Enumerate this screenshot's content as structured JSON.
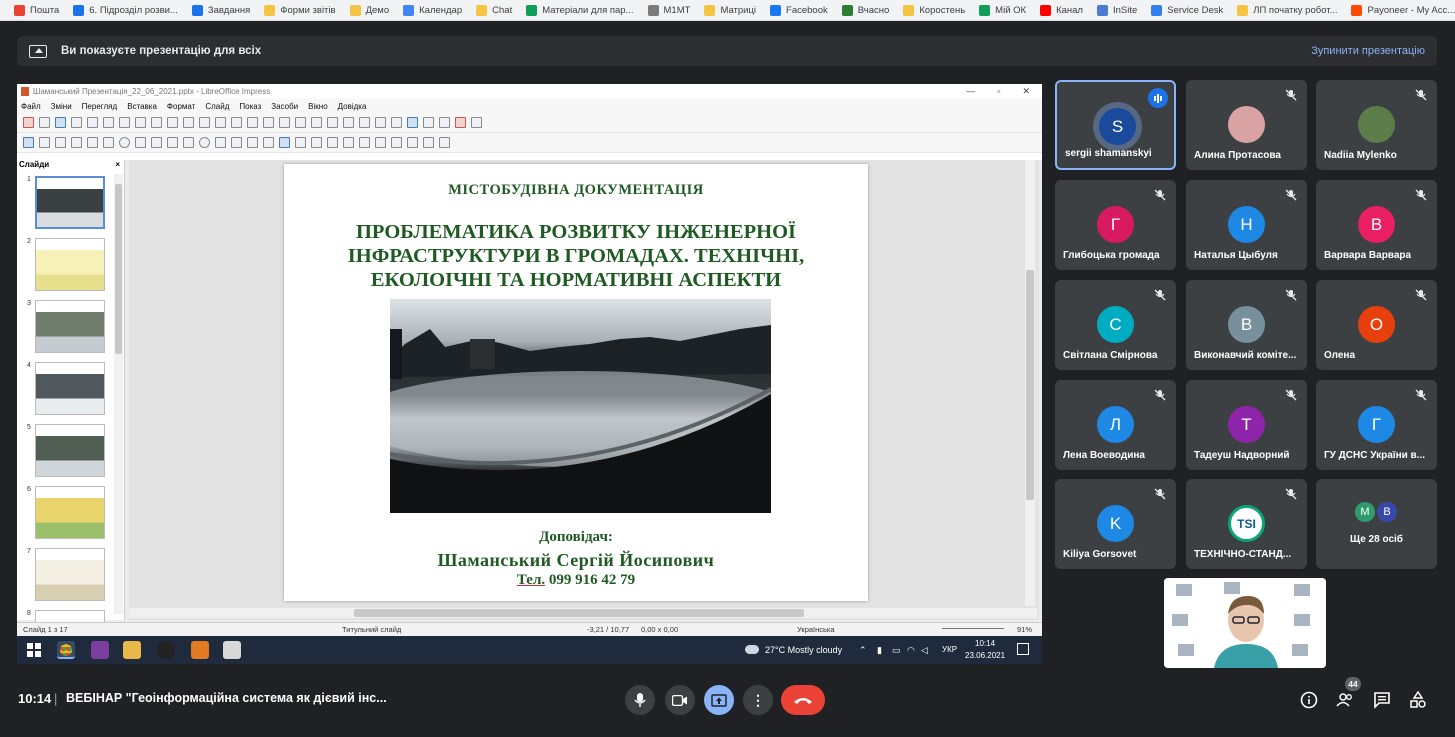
{
  "bookmarks": [
    {
      "label": "Пошта",
      "icon": "gmail-icon",
      "color": "#ea4335"
    },
    {
      "label": "6. Підрозділ розви...",
      "icon": "drive-icon",
      "color": "#1a73e8"
    },
    {
      "label": "Завдання",
      "icon": "calendar-24-icon",
      "color": "#1a73e8"
    },
    {
      "label": "Форми звітів",
      "icon": "folder-icon",
      "color": "#f4c542"
    },
    {
      "label": "Демо",
      "icon": "folder-icon",
      "color": "#f4c542"
    },
    {
      "label": "Календар",
      "icon": "calendar-icon",
      "color": "#4285f4"
    },
    {
      "label": "Chat",
      "icon": "folder-icon",
      "color": "#f4c542"
    },
    {
      "label": "Матеріали для пар...",
      "icon": "sheets-icon",
      "color": "#0f9d58"
    },
    {
      "label": "M1MT",
      "icon": "m1mt-icon",
      "color": "#7b7b7b"
    },
    {
      "label": "Матриці",
      "icon": "folder-icon",
      "color": "#f4c542"
    },
    {
      "label": "Facebook",
      "icon": "facebook-icon",
      "color": "#1877f2"
    },
    {
      "label": "Вчасно",
      "icon": "vchasno-icon",
      "color": "#2e7d32"
    },
    {
      "label": "Коростень",
      "icon": "folder-icon",
      "color": "#f4c542"
    },
    {
      "label": "Мій ОК",
      "icon": "sheets-icon",
      "color": "#0f9d58"
    },
    {
      "label": "Канал",
      "icon": "youtube-icon",
      "color": "#ff0000"
    },
    {
      "label": "InSite",
      "icon": "insite-icon",
      "color": "#4a7bd0"
    },
    {
      "label": "Service Desk",
      "icon": "servicedesk-icon",
      "color": "#2f80ed"
    },
    {
      "label": "ЛП початку робот...",
      "icon": "folder-icon",
      "color": "#f4c542"
    },
    {
      "label": "Payoneer - My Acc...",
      "icon": "payoneer-icon",
      "color": "#ff4800"
    }
  ],
  "banner": {
    "text": "Ви показуєте презентацію для всіх",
    "stop_label": "Зупинити презентацію"
  },
  "shared": {
    "window_title": "Шаманський Презентація_22_06_2021.pptx - LibreOffice Impress",
    "menu": [
      "Файл",
      "Зміни",
      "Перегляд",
      "Вставка",
      "Формат",
      "Слайд",
      "Показ",
      "Засоби",
      "Вікно",
      "Довідка"
    ],
    "slides_label": "Слайди",
    "slide_numbers": [
      "1",
      "2",
      "3",
      "4",
      "5",
      "6",
      "7",
      "8"
    ],
    "slide": {
      "top": "МІСТОБУДІВНА  ДОКУМЕНТАЦІЯ",
      "title": "ПРОБЛЕМАТИКА РОЗВИТКУ ІНЖЕНЕРНОЇ ІНФРАСТРУКТУРИ В ГРОМАДАХ. ТЕХНІЧНІ, ЕКОЛОІЧНІ ТА НОРМАТИВНІ АСПЕКТИ",
      "reporter_label": "Доповідач:",
      "reporter_name": "Шаманський Сергій Йосипович",
      "tel_prefix": "Тел.",
      "tel_number": "099 916 42 79"
    },
    "status": {
      "slide": "Слайд 1 з 17",
      "layout": "Титульний слайд",
      "coords": "-3,21 / 10,77",
      "size": "0,00 x 0,00",
      "lang": "Українська",
      "zoom": "91%"
    },
    "taskbar": {
      "weather": "27°C  Mostly cloudy",
      "lang": "УКР",
      "time": "10:14",
      "date": "23.06.2021"
    }
  },
  "participants": [
    {
      "name": "sergii shamanskyi",
      "initial": "S",
      "color": "#1a4a9c",
      "speaking": true,
      "muted": false
    },
    {
      "name": "Алина Протасова",
      "initial": "",
      "color": "#d9a3a3",
      "photo": true,
      "muted": true
    },
    {
      "name": "Nadiia Mylenko",
      "initial": "",
      "color": "#5c7d4a",
      "photo": true,
      "muted": true
    },
    {
      "name": "Глибоцька громада",
      "initial": "Г",
      "color": "#d81b60",
      "muted": true
    },
    {
      "name": "Наталья Цыбуля",
      "initial": "Н",
      "color": "#1e88e5",
      "muted": true
    },
    {
      "name": "Варвара Варвара",
      "initial": "В",
      "color": "#e91e63",
      "muted": true
    },
    {
      "name": "Світлана Смірнова",
      "initial": "С",
      "color": "#00acc1",
      "muted": true
    },
    {
      "name": "Виконавчий коміте...",
      "initial": "В",
      "color": "#78909c",
      "muted": true
    },
    {
      "name": "Олена",
      "initial": "О",
      "color": "#e8400c",
      "muted": true
    },
    {
      "name": "Лена Воеводина",
      "initial": "Л",
      "color": "#1e88e5",
      "muted": true
    },
    {
      "name": "Тадеуш Надворний",
      "initial": "Т",
      "color": "#8e24aa",
      "muted": true
    },
    {
      "name": "ГУ ДСНС України в...",
      "initial": "Г",
      "color": "#1e88e5",
      "muted": true
    },
    {
      "name": "Kiliya Gorsovet",
      "initial": "K",
      "color": "#1e88e5",
      "muted": true
    },
    {
      "name": "ТЕХНІЧНО-СТАНД...",
      "initial": "TSI",
      "color": "#ffffff",
      "logo": true,
      "muted": true
    }
  ],
  "more": {
    "label": "Ще 28 осіб",
    "avatars": [
      {
        "initial": "M",
        "color": "#2e9c6a"
      },
      {
        "initial": "B",
        "color": "#3949ab"
      }
    ]
  },
  "bottom": {
    "time": "10:14",
    "separator": "|",
    "meeting_title": "ВЕБІНАР \"Геоінформаційна система як дієвий інс...",
    "participants_count": "44"
  }
}
